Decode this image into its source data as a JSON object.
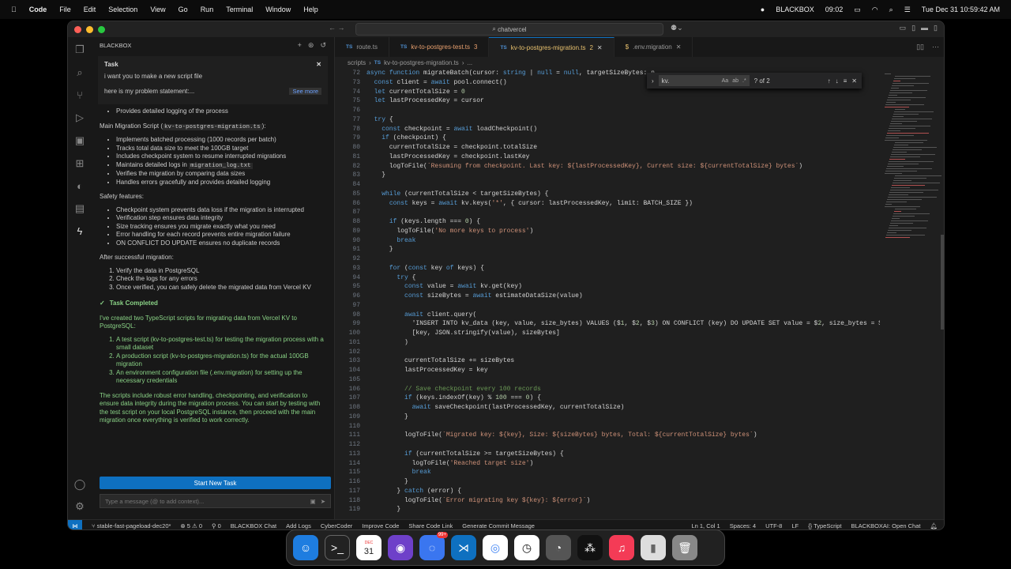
{
  "menubar": {
    "app": "Code",
    "items": [
      "File",
      "Edit",
      "Selection",
      "View",
      "Go",
      "Run",
      "Terminal",
      "Window",
      "Help"
    ],
    "right_app": "BLACKBOX",
    "time_small": "09:02",
    "datetime": "Tue Dec 31  10:59:42 AM"
  },
  "window": {
    "search": "chatvercel"
  },
  "sidebar": {
    "title": "BLACKBOX",
    "task": {
      "label": "Task",
      "line1": "i want you to make a new script file",
      "line2": "here is my problem statement:...",
      "see_more": "See more"
    },
    "top_bullet": "Provides detailed logging of the process",
    "main_script_intro": "Main Migration Script (",
    "main_script_code": "kv-to-postgres-migration.ts",
    "main_script_tail": "):",
    "main_bullets": [
      "Implements batched processing (1000 records per batch)",
      "Tracks total data size to meet the 100GB target",
      "Includes checkpoint system to resume interrupted migrations"
    ],
    "logs_prefix": "Maintains detailed logs in ",
    "logs_code": "migration_log.txt",
    "main_bullets2": [
      "Verifies the migration by comparing data sizes",
      "Handles errors gracefully and provides detailed logging"
    ],
    "safety_title": "Safety features:",
    "safety": [
      "Checkpoint system prevents data loss if the migration is interrupted",
      "Verification step ensures data integrity",
      "Size tracking ensures you migrate exactly what you need",
      "Error handling for each record prevents entire migration failure",
      "ON CONFLICT DO UPDATE ensures no duplicate records"
    ],
    "after_title": "After successful migration:",
    "after": [
      "Verify the data in PostgreSQL",
      "Check the logs for any errors",
      "Once verified, you can safely delete the migrated data from Vercel KV"
    ],
    "completed": "Task Completed",
    "summary": "I've created two TypeScript scripts for migrating data from Vercel KV to PostgreSQL:",
    "summary_items": [
      "A test script (kv-to-postgres-test.ts) for testing the migration process with a small dataset",
      "A production script (kv-to-postgres-migration.ts) for the actual 100GB migration",
      "An environment configuration file (.env.migration) for setting up the necessary credentials"
    ],
    "closing": "The scripts include robust error handling, checkpointing, and verification to ensure data integrity during the migration process. You can start by testing with the test script on your local PostgreSQL instance, then proceed with the main migration once everything is verified to work correctly.",
    "start_button": "Start New Task",
    "placeholder": "Type a message (@ to add context)..."
  },
  "tabs": [
    {
      "icon": "TS",
      "label": "route.ts",
      "badge": ""
    },
    {
      "icon": "TS",
      "label": "kv-to-postgres-test.ts",
      "badge": "3"
    },
    {
      "icon": "TS",
      "label": "kv-to-postgres-migration.ts",
      "badge": "2"
    },
    {
      "icon": "$",
      "label": ".env.migration",
      "badge": ""
    }
  ],
  "breadcrumb": {
    "folder": "scripts",
    "file": "kv-to-postgres-migration.ts",
    "tail": "..."
  },
  "find": {
    "query": "kv.",
    "count": "? of 2"
  },
  "code": [
    [
      "72",
      "async function migrateBatch(cursor: string | null = null, targetSizeBytes: n"
    ],
    [
      "73",
      "  const client = await pool.connect()"
    ],
    [
      "74",
      "  let currentTotalSize = 0"
    ],
    [
      "75",
      "  let lastProcessedKey = cursor"
    ],
    [
      "76",
      ""
    ],
    [
      "77",
      "  try {"
    ],
    [
      "78",
      "    const checkpoint = await loadCheckpoint()"
    ],
    [
      "79",
      "    if (checkpoint) {"
    ],
    [
      "80",
      "      currentTotalSize = checkpoint.totalSize"
    ],
    [
      "81",
      "      lastProcessedKey = checkpoint.lastKey"
    ],
    [
      "82",
      "      logToFile(`Resuming from checkpoint. Last key: ${lastProcessedKey}, Current size: ${currentTotalSize} bytes`)"
    ],
    [
      "83",
      "    }"
    ],
    [
      "84",
      ""
    ],
    [
      "85",
      "    while (currentTotalSize < targetSizeBytes) {"
    ],
    [
      "86",
      "      const keys = await kv.keys('*', { cursor: lastProcessedKey, limit: BATCH_SIZE })"
    ],
    [
      "87",
      ""
    ],
    [
      "88",
      "      if (keys.length === 0) {"
    ],
    [
      "89",
      "        logToFile('No more keys to process')"
    ],
    [
      "90",
      "        break"
    ],
    [
      "91",
      "      }"
    ],
    [
      "92",
      ""
    ],
    [
      "93",
      "      for (const key of keys) {"
    ],
    [
      "94",
      "        try {"
    ],
    [
      "95",
      "          const value = await kv.get(key)"
    ],
    [
      "96",
      "          const sizeBytes = await estimateDataSize(value)"
    ],
    [
      "97",
      ""
    ],
    [
      "98",
      "          await client.query("
    ],
    [
      "99",
      "            'INSERT INTO kv_data (key, value, size_bytes) VALUES ($1, $2, $3) ON CONFLICT (key) DO UPDATE SET value = $2, size_bytes = $"
    ],
    [
      "100",
      "            [key, JSON.stringify(value), sizeBytes]"
    ],
    [
      "101",
      "          )"
    ],
    [
      "102",
      ""
    ],
    [
      "103",
      "          currentTotalSize += sizeBytes"
    ],
    [
      "104",
      "          lastProcessedKey = key"
    ],
    [
      "105",
      ""
    ],
    [
      "106",
      "          // Save checkpoint every 100 records"
    ],
    [
      "107",
      "          if (keys.indexOf(key) % 100 === 0) {"
    ],
    [
      "108",
      "            await saveCheckpoint(lastProcessedKey, currentTotalSize)"
    ],
    [
      "109",
      "          }"
    ],
    [
      "110",
      ""
    ],
    [
      "111",
      "          logToFile(`Migrated key: ${key}, Size: ${sizeBytes} bytes, Total: ${currentTotalSize} bytes`)"
    ],
    [
      "112",
      ""
    ],
    [
      "113",
      "          if (currentTotalSize >= targetSizeBytes) {"
    ],
    [
      "114",
      "            logToFile('Reached target size')"
    ],
    [
      "115",
      "            break"
    ],
    [
      "116",
      "          }"
    ],
    [
      "117",
      "        } catch (error) {"
    ],
    [
      "118",
      "          logToFile(`Error migrating key ${key}: ${error}`)"
    ],
    [
      "119",
      "        }"
    ]
  ],
  "status": {
    "branch": "stable-fast-pageload-dec20*",
    "problems": "⊗ 5 ⚠ 0",
    "ports": "⚲ 0",
    "items": [
      "BLACKBOX Chat",
      "Add Logs",
      "CyberCoder",
      "Improve Code",
      "Share Code Link",
      "Generate Commit Message"
    ],
    "right": [
      "Ln 1, Col 1",
      "Spaces: 4",
      "UTF-8",
      "LF",
      "{} TypeScript",
      "BLACKBOXAI: Open Chat"
    ]
  },
  "dock": {
    "calendar_month": "DEC",
    "calendar_day": "31",
    "badge": "99+"
  }
}
